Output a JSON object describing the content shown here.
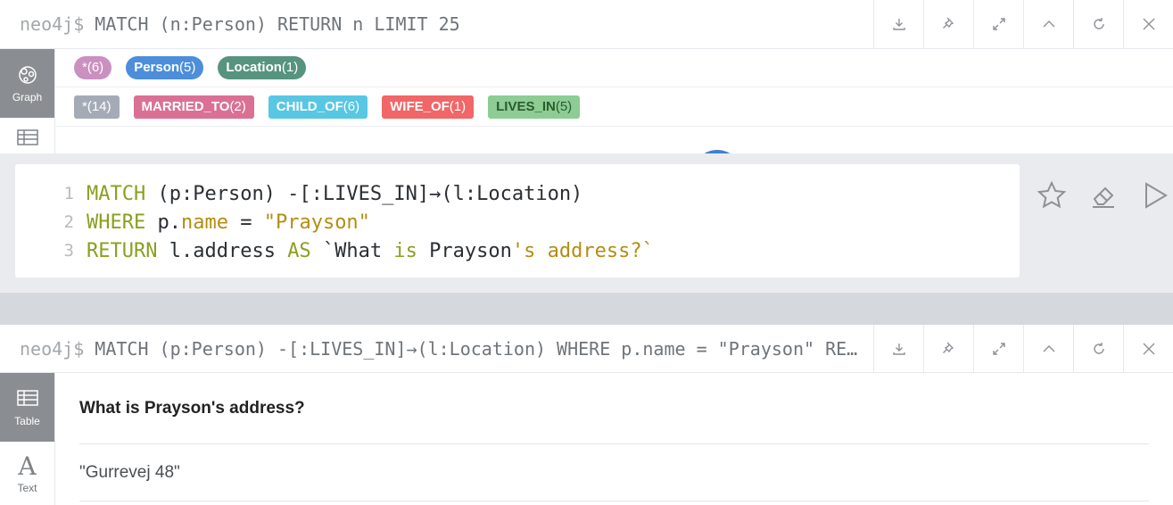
{
  "frame1": {
    "prompt": "neo4j$",
    "command": "MATCH (n:Person) RETURN n LIMIT 25",
    "side": {
      "graph_label": "Graph"
    },
    "node_labels": [
      {
        "name": "*",
        "count": "(6)",
        "color": "#c990c0"
      },
      {
        "name": "Person",
        "count": "(5)",
        "color": "#4c8eda"
      },
      {
        "name": "Location",
        "count": "(1)",
        "color": "#569480"
      }
    ],
    "relationship_types": [
      {
        "name": "*",
        "count": "(14)",
        "color": "#a5abb6",
        "text_color": "#ffffff"
      },
      {
        "name": "MARRIED_TO",
        "count": "(2)",
        "color": "#da7194",
        "text_color": "#ffffff"
      },
      {
        "name": "CHILD_OF",
        "count": "(6)",
        "color": "#57c7e3",
        "text_color": "#ffffff"
      },
      {
        "name": "WIFE_OF",
        "count": "(1)",
        "color": "#f16667",
        "text_color": "#ffffff"
      },
      {
        "name": "LIVES_IN",
        "count": "(5)",
        "color": "#8dcc93",
        "text_color": "#2a5b2e"
      }
    ]
  },
  "editor": {
    "lines": [
      {
        "num": "1",
        "kw1": "MATCH",
        "rest": " (p:Person) -[:LIVES_IN]→(l:Location)"
      },
      {
        "num": "2",
        "kw1": "WHERE",
        "rest1": " p.",
        "prop": "name",
        "rest2": " = ",
        "str": "\"Prayson\""
      },
      {
        "num": "3",
        "kw1": "RETURN",
        "rest1": " l.address ",
        "kw2": "AS",
        "rest2": " `What ",
        "kw3": "is",
        "rest3": " Prayson",
        "str": "'s address?`"
      }
    ]
  },
  "frame2": {
    "prompt": "neo4j$",
    "command": "MATCH (p:Person) -[:LIVES_IN]→(l:Location) WHERE p.name = \"Prayson\" RETURN l.address AS `What is Prayson's address?`",
    "side": {
      "table_label": "Table",
      "text_label": "Text"
    },
    "table": {
      "header": "What is Prayson's address?",
      "rows": [
        "\"Gurrevej 48\""
      ]
    }
  },
  "colors": {
    "accent_blue": "#3f7fd1",
    "keyword_green": "#8aa01f",
    "string_gold": "#b48d12"
  }
}
